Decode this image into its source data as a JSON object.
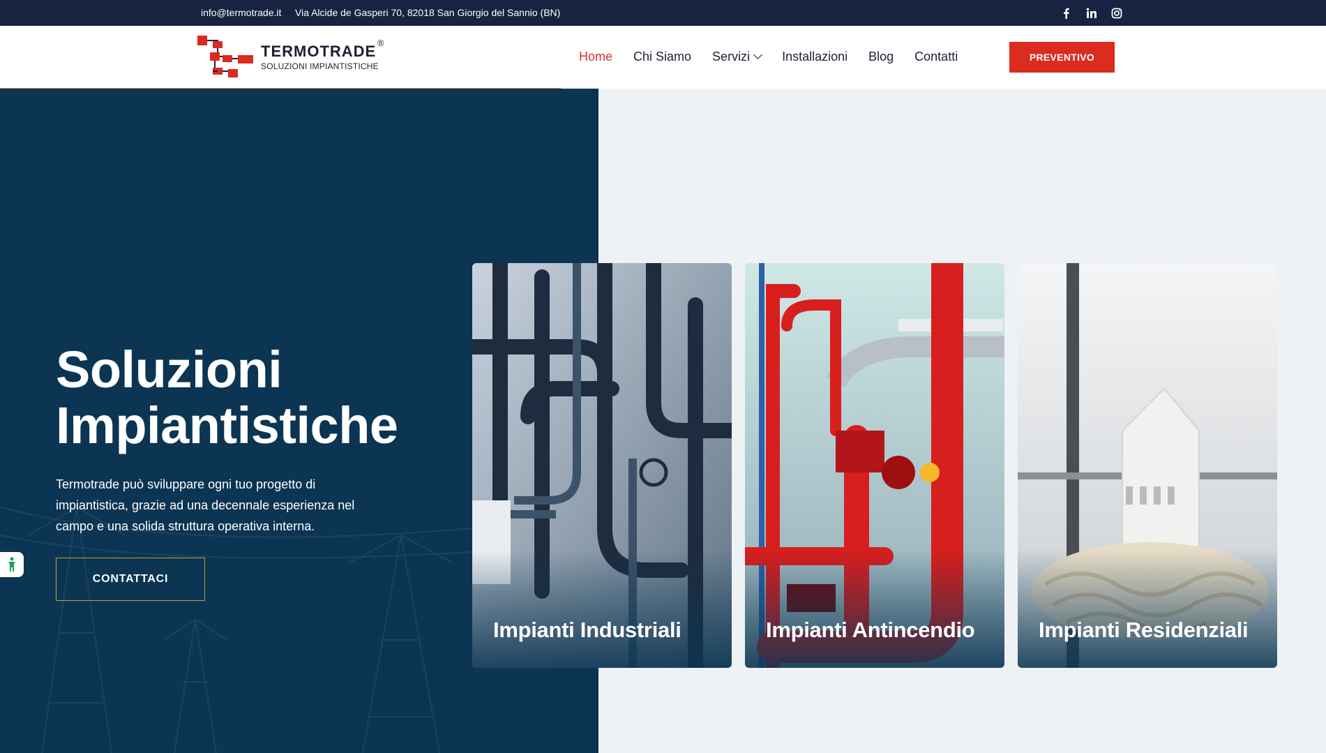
{
  "topbar": {
    "email": "info@termotrade.it",
    "address": "Via Alcide de Gasperi 70, 82018 San Giorgio del Sannio (BN)",
    "social": [
      "facebook-icon",
      "linkedin-icon",
      "instagram-icon"
    ]
  },
  "brand": {
    "name": "TERMOTRADE",
    "registered": "®",
    "tagline": "SOLUZIONI IMPIANTISTICHE"
  },
  "nav": {
    "items": [
      {
        "label": "Home",
        "active": true
      },
      {
        "label": "Chi Siamo"
      },
      {
        "label": "Servizi",
        "has_dropdown": true
      },
      {
        "label": "Installazioni"
      },
      {
        "label": "Blog"
      },
      {
        "label": "Contatti"
      }
    ],
    "cta": "PREVENTIVO"
  },
  "hero": {
    "title_line1": "Soluzioni",
    "title_line2": "Impiantistiche",
    "text": "Termotrade può sviluppare ogni tuo progetto di impiantistica, grazie ad una decennale esperienza nel campo e una solida struttura operativa interna.",
    "button": "CONTATTACI"
  },
  "cards": [
    {
      "label": "Impianti Industriali"
    },
    {
      "label": "Impianti Antincendio"
    },
    {
      "label": "Impianti Residenziali"
    }
  ],
  "colors": {
    "topbar": "#172340",
    "hero_bg": "#0b3552",
    "accent_red": "#dc2b1f",
    "nav_active": "#d5322b",
    "underline_orange": "#e98a2c",
    "button_border": "#c9a13b",
    "page_bg": "#eef2f5"
  }
}
